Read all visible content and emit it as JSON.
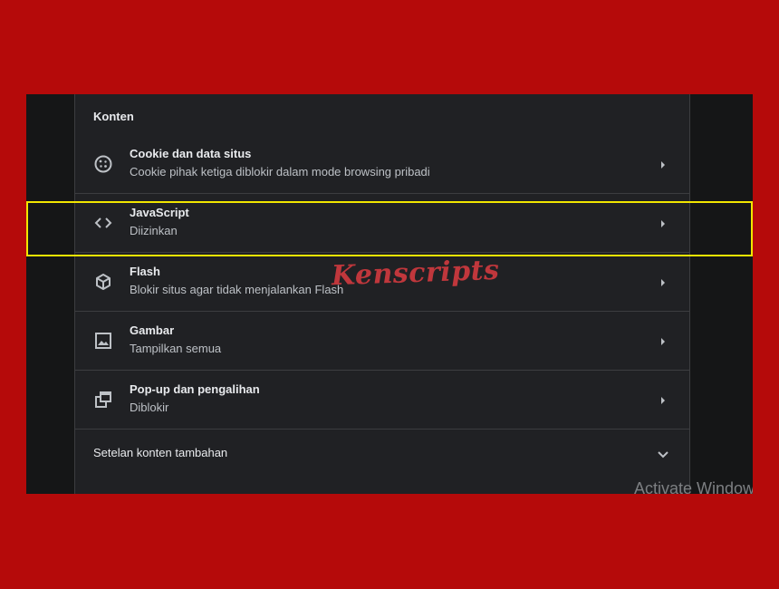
{
  "section": {
    "title": "Konten"
  },
  "rows": [
    {
      "title": "Cookie dan data situs",
      "subtitle": "Cookie pihak ketiga diblokir dalam mode browsing pribadi",
      "icon": "cookie-icon"
    },
    {
      "title": "JavaScript",
      "subtitle": "Diizinkan",
      "icon": "code-icon"
    },
    {
      "title": "Flash",
      "subtitle": "Blokir situs agar tidak menjalankan Flash",
      "icon": "cube-icon"
    },
    {
      "title": "Gambar",
      "subtitle": "Tampilkan semua",
      "icon": "image-icon"
    },
    {
      "title": "Pop-up dan pengalihan",
      "subtitle": "Diblokir",
      "icon": "popup-icon"
    }
  ],
  "extra": {
    "label": "Setelan konten tambahan",
    "icon": "chevron-down-icon"
  },
  "overlays": {
    "watermark": "Kenscripts",
    "activate": "Activate Windows"
  },
  "colors": {
    "background": "#b50a0a",
    "panel": "#202124",
    "highlight": "#f2e600"
  }
}
